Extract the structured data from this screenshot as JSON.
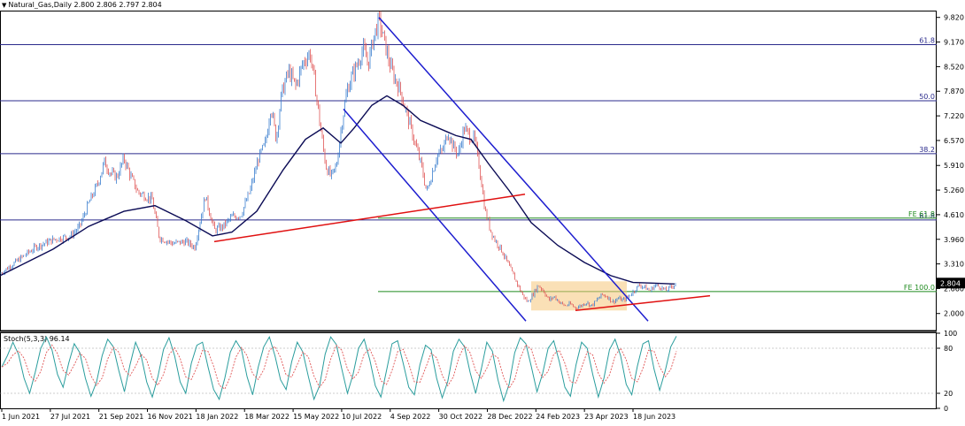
{
  "chart_data": {
    "type": "candlestick",
    "symbol": "Natural_Gas",
    "timeframe": "Daily",
    "header": "Natural_Gas,Daily  2.800 2.806 2.797 2.804",
    "ohlc_last": {
      "open": 2.8,
      "high": 2.806,
      "low": 2.797,
      "close": 2.804
    },
    "last_price_label": "2.804",
    "price_axis": {
      "ticks": [
        "9.820",
        "9.170",
        "8.520",
        "7.870",
        "7.220",
        "6.570",
        "5.910",
        "5.260",
        "4.610",
        "3.960",
        "3.310",
        "2.660",
        "2.000"
      ],
      "range": [
        1.55,
        10.0
      ]
    },
    "time_axis": {
      "ticks": [
        "1 Jun 2021",
        "27 Jul 2021",
        "21 Sep 2021",
        "16 Nov 2021",
        "18 Jan 2022",
        "18 Mar 2022",
        "15 May 2022",
        "10 Jul 2022",
        "4 Sep 2022",
        "30 Oct 2022",
        "28 Dec 2022",
        "24 Feb 2023",
        "23 Apr 2023",
        "18 Jun 2023"
      ]
    },
    "fibonacci_retracement": [
      {
        "label": "61.8",
        "price": 9.1
      },
      {
        "label": "50.0",
        "price": 7.62
      },
      {
        "label": "38.2",
        "price": 6.22
      },
      {
        "label": "61.8",
        "price": 4.47
      }
    ],
    "fibonacci_expansion": [
      {
        "label": "FE 61.8",
        "price": 4.52
      },
      {
        "label": "FE 100.0",
        "price": 2.58
      }
    ],
    "close_path": [
      [
        0,
        3.05
      ],
      [
        20,
        3.4
      ],
      [
        40,
        3.75
      ],
      [
        60,
        3.95
      ],
      [
        80,
        4.05
      ],
      [
        90,
        4.3
      ],
      [
        100,
        4.9
      ],
      [
        110,
        5.4
      ],
      [
        118,
        6.0
      ],
      [
        125,
        5.7
      ],
      [
        132,
        5.6
      ],
      [
        140,
        6.1
      ],
      [
        148,
        5.6
      ],
      [
        156,
        5.2
      ],
      [
        165,
        5.1
      ],
      [
        172,
        5.0
      ],
      [
        180,
        4.0
      ],
      [
        195,
        3.85
      ],
      [
        210,
        3.9
      ],
      [
        220,
        3.75
      ],
      [
        232,
        5.1
      ],
      [
        242,
        4.2
      ],
      [
        252,
        4.3
      ],
      [
        262,
        4.55
      ],
      [
        272,
        4.6
      ],
      [
        282,
        5.2
      ],
      [
        292,
        6.1
      ],
      [
        300,
        6.5
      ],
      [
        306,
        7.5
      ],
      [
        312,
        6.6
      ],
      [
        318,
        7.8
      ],
      [
        326,
        8.4
      ],
      [
        334,
        8.0
      ],
      [
        342,
        8.6
      ],
      [
        350,
        8.9
      ],
      [
        356,
        8.0
      ],
      [
        362,
        6.9
      ],
      [
        368,
        5.9
      ],
      [
        374,
        5.6
      ],
      [
        380,
        5.9
      ],
      [
        386,
        7.0
      ],
      [
        392,
        7.9
      ],
      [
        398,
        8.3
      ],
      [
        404,
        8.6
      ],
      [
        410,
        9.0
      ],
      [
        416,
        8.6
      ],
      [
        422,
        9.3
      ],
      [
        428,
        9.75
      ],
      [
        434,
        9.2
      ],
      [
        440,
        8.6
      ],
      [
        446,
        8.2
      ],
      [
        452,
        7.9
      ],
      [
        458,
        7.4
      ],
      [
        464,
        6.9
      ],
      [
        470,
        6.4
      ],
      [
        476,
        5.9
      ],
      [
        482,
        5.2
      ],
      [
        488,
        5.7
      ],
      [
        494,
        6.2
      ],
      [
        500,
        6.3
      ],
      [
        506,
        6.8
      ],
      [
        512,
        6.4
      ],
      [
        518,
        6.2
      ],
      [
        524,
        6.9
      ],
      [
        530,
        6.7
      ],
      [
        536,
        6.6
      ],
      [
        542,
        5.8
      ],
      [
        548,
        4.7
      ],
      [
        554,
        4.2
      ],
      [
        560,
        3.9
      ],
      [
        566,
        3.7
      ],
      [
        572,
        3.4
      ],
      [
        578,
        3.1
      ],
      [
        584,
        2.8
      ],
      [
        590,
        2.5
      ],
      [
        596,
        2.3
      ],
      [
        602,
        2.5
      ],
      [
        608,
        2.75
      ],
      [
        614,
        2.6
      ],
      [
        620,
        2.35
      ],
      [
        626,
        2.45
      ],
      [
        632,
        2.3
      ],
      [
        638,
        2.2
      ],
      [
        644,
        2.25
      ],
      [
        650,
        2.15
      ],
      [
        656,
        2.2
      ],
      [
        662,
        2.3
      ],
      [
        668,
        2.2
      ],
      [
        674,
        2.35
      ],
      [
        680,
        2.5
      ],
      [
        686,
        2.45
      ],
      [
        692,
        2.3
      ],
      [
        698,
        2.4
      ],
      [
        704,
        2.35
      ],
      [
        710,
        2.45
      ],
      [
        716,
        2.6
      ],
      [
        722,
        2.75
      ],
      [
        728,
        2.7
      ],
      [
        734,
        2.6
      ],
      [
        740,
        2.75
      ],
      [
        746,
        2.7
      ],
      [
        752,
        2.6
      ],
      [
        758,
        2.7
      ],
      [
        764,
        2.804
      ]
    ],
    "moving_average_path": [
      [
        0,
        3.0
      ],
      [
        60,
        3.7
      ],
      [
        100,
        4.3
      ],
      [
        140,
        4.7
      ],
      [
        175,
        4.85
      ],
      [
        210,
        4.45
      ],
      [
        240,
        4.05
      ],
      [
        262,
        4.15
      ],
      [
        290,
        4.7
      ],
      [
        320,
        5.8
      ],
      [
        345,
        6.6
      ],
      [
        365,
        6.9
      ],
      [
        385,
        6.5
      ],
      [
        400,
        6.9
      ],
      [
        420,
        7.5
      ],
      [
        437,
        7.75
      ],
      [
        455,
        7.5
      ],
      [
        475,
        7.1
      ],
      [
        495,
        6.9
      ],
      [
        515,
        6.7
      ],
      [
        532,
        6.6
      ],
      [
        552,
        5.95
      ],
      [
        575,
        5.25
      ],
      [
        600,
        4.4
      ],
      [
        630,
        3.8
      ],
      [
        660,
        3.35
      ],
      [
        690,
        3.0
      ],
      [
        715,
        2.82
      ],
      [
        740,
        2.8
      ],
      [
        762,
        2.78
      ]
    ],
    "trendlines": [
      {
        "color": "blue",
        "from": [
          428,
          9.82
        ],
        "to": [
          732,
          1.8
        ]
      },
      {
        "color": "blue",
        "from": [
          388,
          7.4
        ],
        "to": [
          594,
          1.8
        ]
      },
      {
        "color": "red",
        "from": [
          242,
          3.9
        ],
        "to": [
          593,
          5.15
        ]
      },
      {
        "color": "red",
        "from": [
          650,
          2.08
        ],
        "to": [
          802,
          2.47
        ]
      }
    ],
    "zone": {
      "from": [
        600,
        2.85
      ],
      "to": [
        708,
        2.08
      ]
    },
    "stochastic": {
      "label": "Stoch(5,3,3) 96.14",
      "ticks": [
        "100",
        "80",
        "20",
        "0"
      ],
      "range": [
        0,
        100
      ],
      "values": [
        55,
        70,
        88,
        72,
        40,
        20,
        48,
        80,
        95,
        78,
        45,
        28,
        60,
        86,
        74,
        40,
        16,
        35,
        70,
        92,
        82,
        50,
        22,
        58,
        88,
        70,
        35,
        15,
        42,
        78,
        94,
        70,
        35,
        20,
        60,
        84,
        88,
        55,
        25,
        12,
        40,
        75,
        90,
        78,
        42,
        18,
        55,
        82,
        95,
        70,
        38,
        25,
        62,
        88,
        75,
        42,
        12,
        30,
        72,
        95,
        85,
        52,
        20,
        45,
        80,
        92,
        65,
        30,
        15,
        50,
        86,
        90,
        60,
        28,
        18,
        58,
        84,
        78,
        40,
        14,
        36,
        76,
        92,
        82,
        48,
        20,
        52,
        88,
        76,
        38,
        10,
        32,
        74,
        94,
        86,
        55,
        22,
        46,
        80,
        90,
        62,
        28,
        16,
        58,
        88,
        80,
        45,
        15,
        40,
        78,
        92,
        70,
        32,
        18,
        56,
        86,
        90,
        52,
        24,
        50,
        82,
        96
      ]
    }
  }
}
